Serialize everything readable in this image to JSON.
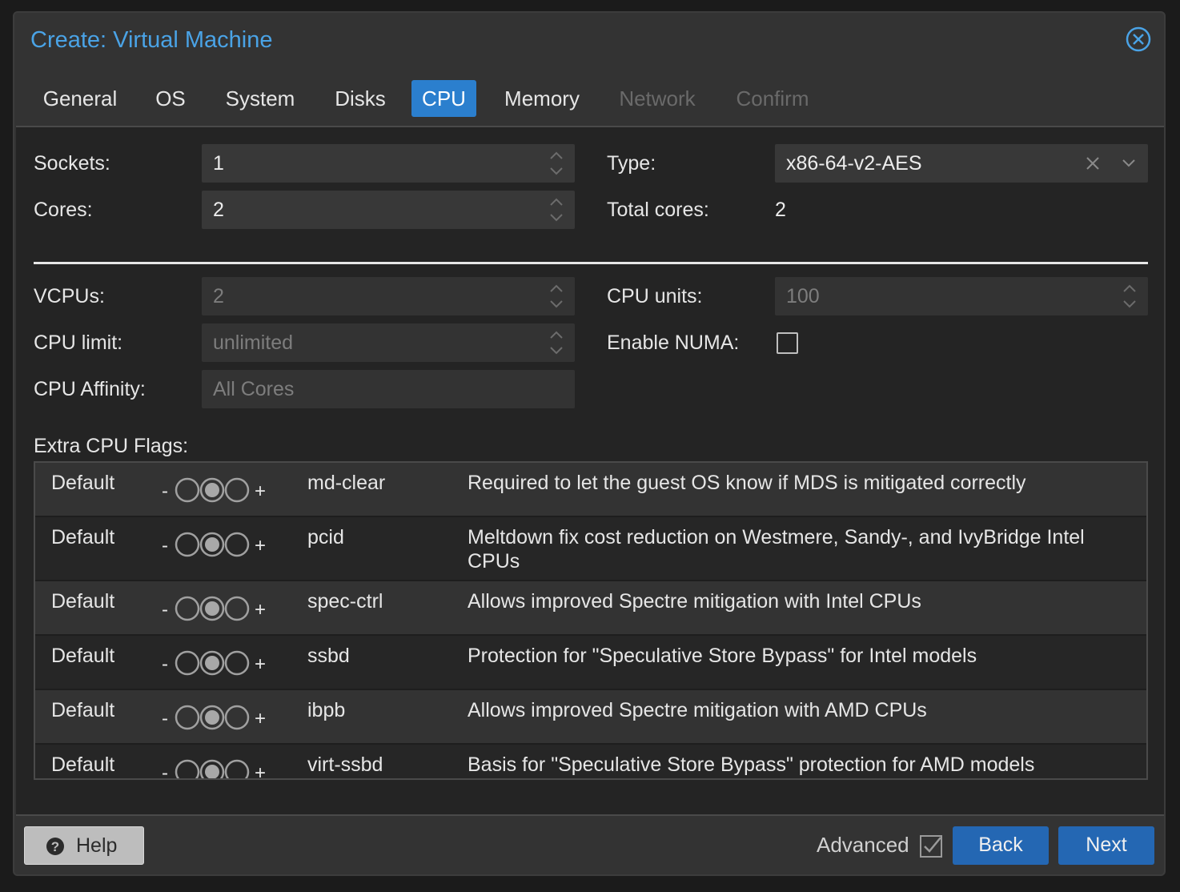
{
  "window": {
    "title": "Create: Virtual Machine"
  },
  "tabs": [
    {
      "label": "General",
      "state": "normal"
    },
    {
      "label": "OS",
      "state": "normal"
    },
    {
      "label": "System",
      "state": "normal"
    },
    {
      "label": "Disks",
      "state": "normal"
    },
    {
      "label": "CPU",
      "state": "active"
    },
    {
      "label": "Memory",
      "state": "normal"
    },
    {
      "label": "Network",
      "state": "disabled"
    },
    {
      "label": "Confirm",
      "state": "disabled"
    }
  ],
  "form": {
    "sockets_label": "Sockets:",
    "sockets_value": "1",
    "cores_label": "Cores:",
    "cores_value": "2",
    "type_label": "Type:",
    "type_value": "x86-64-v2-AES",
    "total_cores_label": "Total cores:",
    "total_cores_value": "2",
    "vcpus_label": "VCPUs:",
    "vcpus_value": "2",
    "cpu_limit_label": "CPU limit:",
    "cpu_limit_value": "unlimited",
    "cpu_affinity_label": "CPU Affinity:",
    "cpu_affinity_placeholder": "All Cores",
    "cpu_units_label": "CPU units:",
    "cpu_units_value": "100",
    "numa_label": "Enable NUMA:",
    "numa_checked": false
  },
  "flags": {
    "heading": "Extra CPU Flags:",
    "minus": "-",
    "plus": "+",
    "rows": [
      {
        "state": "Default",
        "name": "md-clear",
        "description": "Required to let the guest OS know if MDS is mitigated correctly",
        "description2": ""
      },
      {
        "state": "Default",
        "name": "pcid",
        "description": "Meltdown fix cost reduction on Westmere, Sandy-, and IvyBridge Intel",
        "description2": "CPUs"
      },
      {
        "state": "Default",
        "name": "spec-ctrl",
        "description": "Allows improved Spectre mitigation with Intel CPUs",
        "description2": ""
      },
      {
        "state": "Default",
        "name": "ssbd",
        "description": "Protection for \"Speculative Store Bypass\" for Intel models",
        "description2": ""
      },
      {
        "state": "Default",
        "name": "ibpb",
        "description": "Allows improved Spectre mitigation with AMD CPUs",
        "description2": ""
      },
      {
        "state": "Default",
        "name": "virt-ssbd",
        "description": "Basis for \"Speculative Store Bypass\" protection for AMD models",
        "description2": ""
      }
    ]
  },
  "footer": {
    "help_label": "Help",
    "advanced_label": "Advanced",
    "advanced_checked": true,
    "back_label": "Back",
    "next_label": "Next"
  },
  "colors": {
    "accent": "#2b7fce",
    "title": "#4aa3e6",
    "button_primary": "#2467b3",
    "panel": "#242424"
  },
  "icons": {
    "close": "close-circle-icon",
    "help": "question-circle-icon",
    "spin": "spinner-arrows-icon",
    "clear": "clear-x-icon",
    "dropdown": "chevron-down-icon"
  }
}
